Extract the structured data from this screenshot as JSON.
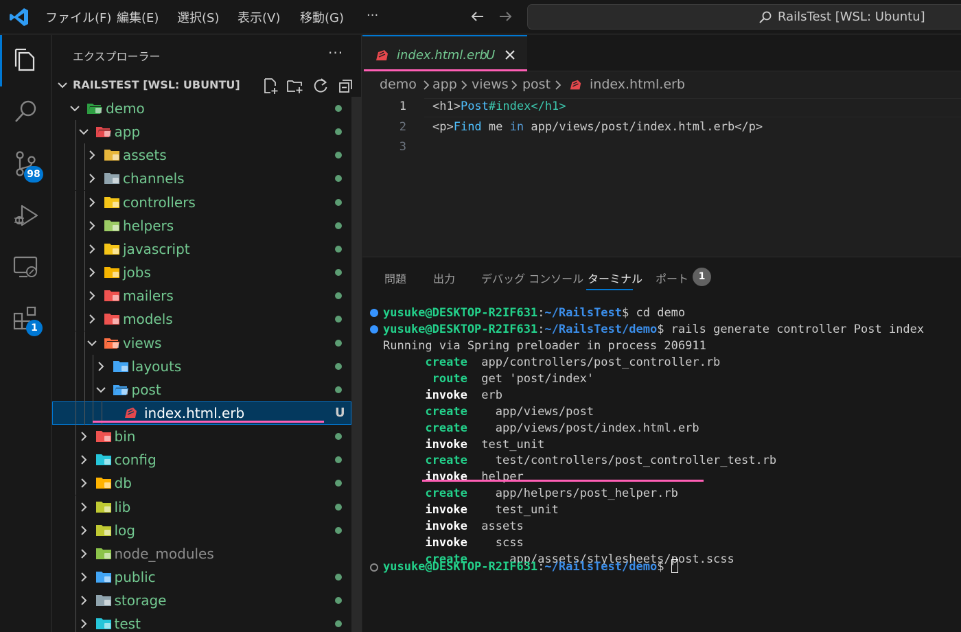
{
  "titlebar": {
    "menu": [
      "ファイル(F)",
      "編集(E)",
      "選択(S)",
      "表示(V)",
      "移動(G)",
      "···"
    ],
    "command_center": "RailsTest [WSL: Ubuntu]"
  },
  "activity": {
    "scm_badge": "98",
    "extensions_badge": "1"
  },
  "sidebar": {
    "title": "エクスプローラー",
    "more": "···",
    "workspace": "RAILSTEST [WSL: UBUNTU]",
    "tree": [
      {
        "label": "demo",
        "icon": "folder-demo-icon",
        "color": "#2ea043"
      },
      {
        "label": "app",
        "icon": "folder-app-icon",
        "color": "#e5484d"
      },
      {
        "label": "assets",
        "icon": "folder-assets-icon",
        "color": "#e8b73c"
      },
      {
        "label": "channels",
        "icon": "folder-channels-icon",
        "color": "#90a4ae"
      },
      {
        "label": "controllers",
        "icon": "folder-controllers-icon",
        "color": "#f5c518"
      },
      {
        "label": "helpers",
        "icon": "folder-helpers-icon",
        "color": "#9ccc65"
      },
      {
        "label": "javascript",
        "icon": "folder-javascript-icon",
        "color": "#f5c518"
      },
      {
        "label": "jobs",
        "icon": "folder-jobs-icon",
        "color": "#f5b400"
      },
      {
        "label": "mailers",
        "icon": "folder-mailers-icon",
        "color": "#ef5350"
      },
      {
        "label": "models",
        "icon": "folder-models-icon",
        "color": "#ef5350"
      },
      {
        "label": "views",
        "icon": "folder-views-icon",
        "color": "#ff7043"
      },
      {
        "label": "layouts",
        "icon": "folder-layouts-icon",
        "color": "#42a5f5"
      },
      {
        "label": "post",
        "icon": "folder-post-icon",
        "color": "#42a5f5"
      },
      {
        "label": "index.html.erb",
        "icon": "erb-file-icon",
        "color": "#e5484d",
        "status": "U"
      },
      {
        "label": "bin",
        "icon": "folder-bin-icon",
        "color": "#ef5350"
      },
      {
        "label": "config",
        "icon": "folder-config-icon",
        "color": "#26c6da"
      },
      {
        "label": "db",
        "icon": "folder-db-icon",
        "color": "#ffb300"
      },
      {
        "label": "lib",
        "icon": "folder-lib-icon",
        "color": "#c0ca33"
      },
      {
        "label": "log",
        "icon": "folder-log-icon",
        "color": "#c0ca33"
      },
      {
        "label": "node_modules",
        "icon": "folder-node-modules-icon",
        "color": "#8bc34a"
      },
      {
        "label": "public",
        "icon": "folder-public-icon",
        "color": "#42a5f5"
      },
      {
        "label": "storage",
        "icon": "folder-storage-icon",
        "color": "#90a4ae"
      },
      {
        "label": "test",
        "icon": "folder-test-icon",
        "color": "#26c6da"
      }
    ]
  },
  "editor": {
    "tab_label": "index.html.erb",
    "tab_status": "U",
    "breadcrumb": [
      "demo",
      "app",
      "views",
      "post",
      "index.html.erb"
    ],
    "lines": [
      {
        "num": "1",
        "open": "<h1>",
        "word1": "Post",
        "rest": "#index",
        "close": "</h1>"
      },
      {
        "num": "2",
        "open": "<p>",
        "word1": "Find",
        "sp1": " ",
        "word2": "me",
        "sp2": " ",
        "word3": "in",
        "rest": " app/views/post/index.html.erb",
        "close": "</p>"
      },
      {
        "num": "3"
      }
    ]
  },
  "panel": {
    "tabs": [
      "問題",
      "出力",
      "デバッグ コンソール",
      "ターミナル",
      "ポート"
    ],
    "ports_badge": "1",
    "terminal": {
      "prompt_user": "yusuke@DESKTOP-R2IF631",
      "prompt_colon": ":",
      "path1": "~/RailsTest",
      "path2": "~/RailsTest/demo",
      "dollar": "$",
      "cmd1": " cd demo",
      "cmd2": " rails generate controller Post index",
      "running": "Running via Spring preloader in process 206911",
      "lines": [
        {
          "verb": "      create",
          "kind": "green",
          "arg": "  app/controllers/post_controller.rb"
        },
        {
          "verb": "       route",
          "kind": "green",
          "arg": "  get 'post/index'"
        },
        {
          "verb": "      invoke",
          "kind": "white",
          "arg": "  erb"
        },
        {
          "verb": "      create",
          "kind": "green",
          "arg": "    app/views/post"
        },
        {
          "verb": "      create",
          "kind": "green",
          "arg": "    app/views/post/index.html.erb"
        },
        {
          "verb": "      invoke",
          "kind": "white",
          "arg": "  test_unit"
        },
        {
          "verb": "      create",
          "kind": "green",
          "arg": "    test/controllers/post_controller_test.rb"
        },
        {
          "verb": "      invoke",
          "kind": "white",
          "arg": "  helper"
        },
        {
          "verb": "      create",
          "kind": "green",
          "arg": "    app/helpers/post_helper.rb"
        },
        {
          "verb": "      invoke",
          "kind": "white",
          "arg": "    test_unit"
        },
        {
          "verb": "      invoke",
          "kind": "white",
          "arg": "  assets"
        },
        {
          "verb": "      invoke",
          "kind": "white",
          "arg": "    scss"
        },
        {
          "verb": "      create",
          "kind": "green",
          "arg": "      app/assets/stylesheets/post.scss"
        }
      ]
    }
  }
}
